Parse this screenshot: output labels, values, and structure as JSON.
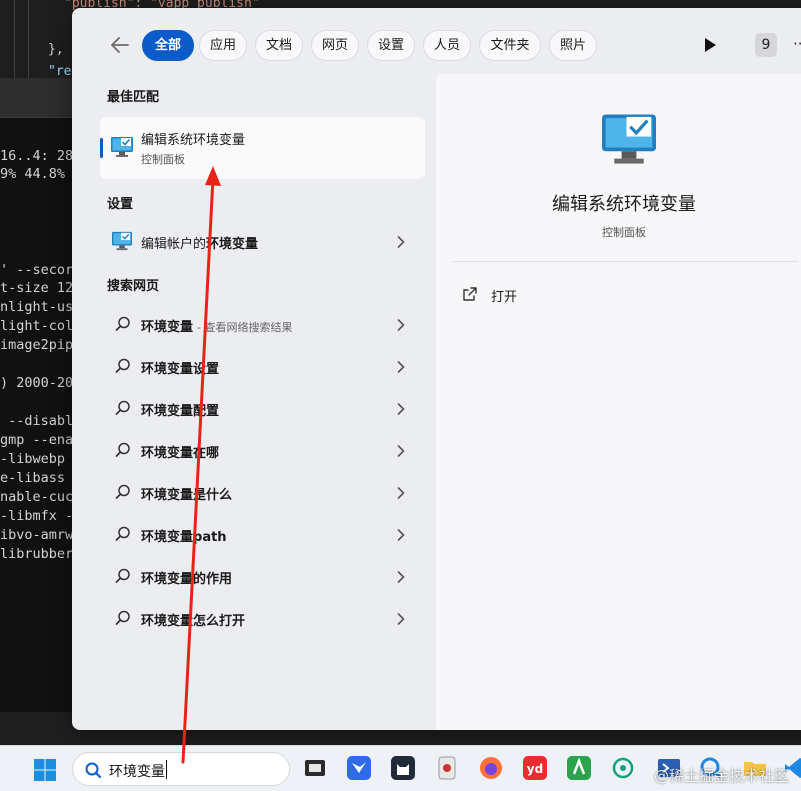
{
  "background": {
    "editor_lines": [
      "\"publish\": \"vapp publish\"",
      "},",
      "\"re"
    ],
    "terminal_lines": [
      "16..4: 28",
      "9% 44.8%",
      "' --secor",
      "t-size 12",
      "nlight-us",
      "light-col",
      "image2pip",
      ") 2000-20",
      " --disabl",
      "gmp --ena",
      "-libwebp",
      "e-libass",
      "nable-cuc",
      "-libmfx -",
      "ibvo-amrw",
      "librubber"
    ]
  },
  "filters": {
    "back_icon": "back-arrow-icon",
    "tabs": [
      {
        "label": "全部",
        "active": true
      },
      {
        "label": "应用",
        "active": false
      },
      {
        "label": "文档",
        "active": false
      },
      {
        "label": "网页",
        "active": false
      },
      {
        "label": "设置",
        "active": false
      },
      {
        "label": "人员",
        "active": false
      },
      {
        "label": "文件夹",
        "active": false
      },
      {
        "label": "照片",
        "active": false
      }
    ],
    "play_icon": "play-icon",
    "badge_count": "9",
    "more_label": "···"
  },
  "best_match": {
    "heading": "最佳匹配",
    "title": "编辑系统环境变量",
    "subtitle": "控制面板",
    "icon": "monitor-check-icon"
  },
  "settings": {
    "heading": "设置",
    "items": [
      {
        "prefix": "编辑帐户的",
        "bold": "环境变量",
        "suffix": ""
      }
    ]
  },
  "web": {
    "heading": "搜索网页",
    "items": [
      {
        "bold": "环境变量",
        "suffix": "",
        "hint": "- 查看网络搜索结果"
      },
      {
        "bold": "环境变量",
        "suffix": "设置",
        "hint": ""
      },
      {
        "bold": "环境变量",
        "suffix": "配置",
        "hint": ""
      },
      {
        "bold": "环境变量",
        "suffix": "在哪",
        "hint": ""
      },
      {
        "bold": "环境变量",
        "suffix": "是什么",
        "hint": ""
      },
      {
        "bold": "环境变量",
        "suffix": "path",
        "hint": ""
      },
      {
        "bold": "环境变量",
        "suffix": "的作用",
        "hint": ""
      },
      {
        "bold": "环境变量",
        "suffix": "怎么打开",
        "hint": ""
      }
    ]
  },
  "detail": {
    "title": "编辑系统环境变量",
    "subtitle": "控制面板",
    "open_label": "打开"
  },
  "taskbar": {
    "search_text": "环境变量",
    "watermark": "@稀土掘金技术社区",
    "apps": [
      "terminal-icon",
      "feishu-icon",
      "cat-icon",
      "db-icon",
      "firefox-icon",
      "youdao-icon",
      "git-icon",
      "chatgpt-icon",
      "powershell-icon",
      "q-icon",
      "folder-icon",
      "vscode-icon"
    ]
  },
  "colors": {
    "accent": "#0b5cc8",
    "annotation_arrow": "#e8241a"
  }
}
